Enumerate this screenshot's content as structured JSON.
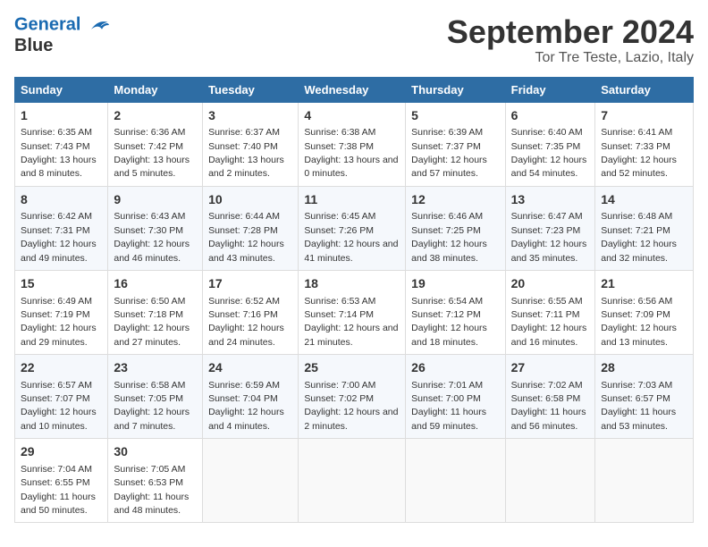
{
  "header": {
    "logo_line1": "General",
    "logo_line2": "Blue",
    "month": "September 2024",
    "location": "Tor Tre Teste, Lazio, Italy"
  },
  "columns": [
    "Sunday",
    "Monday",
    "Tuesday",
    "Wednesday",
    "Thursday",
    "Friday",
    "Saturday"
  ],
  "weeks": [
    [
      {
        "day": "1",
        "sunrise": "Sunrise: 6:35 AM",
        "sunset": "Sunset: 7:43 PM",
        "daylight": "Daylight: 13 hours and 8 minutes."
      },
      {
        "day": "2",
        "sunrise": "Sunrise: 6:36 AM",
        "sunset": "Sunset: 7:42 PM",
        "daylight": "Daylight: 13 hours and 5 minutes."
      },
      {
        "day": "3",
        "sunrise": "Sunrise: 6:37 AM",
        "sunset": "Sunset: 7:40 PM",
        "daylight": "Daylight: 13 hours and 2 minutes."
      },
      {
        "day": "4",
        "sunrise": "Sunrise: 6:38 AM",
        "sunset": "Sunset: 7:38 PM",
        "daylight": "Daylight: 13 hours and 0 minutes."
      },
      {
        "day": "5",
        "sunrise": "Sunrise: 6:39 AM",
        "sunset": "Sunset: 7:37 PM",
        "daylight": "Daylight: 12 hours and 57 minutes."
      },
      {
        "day": "6",
        "sunrise": "Sunrise: 6:40 AM",
        "sunset": "Sunset: 7:35 PM",
        "daylight": "Daylight: 12 hours and 54 minutes."
      },
      {
        "day": "7",
        "sunrise": "Sunrise: 6:41 AM",
        "sunset": "Sunset: 7:33 PM",
        "daylight": "Daylight: 12 hours and 52 minutes."
      }
    ],
    [
      {
        "day": "8",
        "sunrise": "Sunrise: 6:42 AM",
        "sunset": "Sunset: 7:31 PM",
        "daylight": "Daylight: 12 hours and 49 minutes."
      },
      {
        "day": "9",
        "sunrise": "Sunrise: 6:43 AM",
        "sunset": "Sunset: 7:30 PM",
        "daylight": "Daylight: 12 hours and 46 minutes."
      },
      {
        "day": "10",
        "sunrise": "Sunrise: 6:44 AM",
        "sunset": "Sunset: 7:28 PM",
        "daylight": "Daylight: 12 hours and 43 minutes."
      },
      {
        "day": "11",
        "sunrise": "Sunrise: 6:45 AM",
        "sunset": "Sunset: 7:26 PM",
        "daylight": "Daylight: 12 hours and 41 minutes."
      },
      {
        "day": "12",
        "sunrise": "Sunrise: 6:46 AM",
        "sunset": "Sunset: 7:25 PM",
        "daylight": "Daylight: 12 hours and 38 minutes."
      },
      {
        "day": "13",
        "sunrise": "Sunrise: 6:47 AM",
        "sunset": "Sunset: 7:23 PM",
        "daylight": "Daylight: 12 hours and 35 minutes."
      },
      {
        "day": "14",
        "sunrise": "Sunrise: 6:48 AM",
        "sunset": "Sunset: 7:21 PM",
        "daylight": "Daylight: 12 hours and 32 minutes."
      }
    ],
    [
      {
        "day": "15",
        "sunrise": "Sunrise: 6:49 AM",
        "sunset": "Sunset: 7:19 PM",
        "daylight": "Daylight: 12 hours and 29 minutes."
      },
      {
        "day": "16",
        "sunrise": "Sunrise: 6:50 AM",
        "sunset": "Sunset: 7:18 PM",
        "daylight": "Daylight: 12 hours and 27 minutes."
      },
      {
        "day": "17",
        "sunrise": "Sunrise: 6:52 AM",
        "sunset": "Sunset: 7:16 PM",
        "daylight": "Daylight: 12 hours and 24 minutes."
      },
      {
        "day": "18",
        "sunrise": "Sunrise: 6:53 AM",
        "sunset": "Sunset: 7:14 PM",
        "daylight": "Daylight: 12 hours and 21 minutes."
      },
      {
        "day": "19",
        "sunrise": "Sunrise: 6:54 AM",
        "sunset": "Sunset: 7:12 PM",
        "daylight": "Daylight: 12 hours and 18 minutes."
      },
      {
        "day": "20",
        "sunrise": "Sunrise: 6:55 AM",
        "sunset": "Sunset: 7:11 PM",
        "daylight": "Daylight: 12 hours and 16 minutes."
      },
      {
        "day": "21",
        "sunrise": "Sunrise: 6:56 AM",
        "sunset": "Sunset: 7:09 PM",
        "daylight": "Daylight: 12 hours and 13 minutes."
      }
    ],
    [
      {
        "day": "22",
        "sunrise": "Sunrise: 6:57 AM",
        "sunset": "Sunset: 7:07 PM",
        "daylight": "Daylight: 12 hours and 10 minutes."
      },
      {
        "day": "23",
        "sunrise": "Sunrise: 6:58 AM",
        "sunset": "Sunset: 7:05 PM",
        "daylight": "Daylight: 12 hours and 7 minutes."
      },
      {
        "day": "24",
        "sunrise": "Sunrise: 6:59 AM",
        "sunset": "Sunset: 7:04 PM",
        "daylight": "Daylight: 12 hours and 4 minutes."
      },
      {
        "day": "25",
        "sunrise": "Sunrise: 7:00 AM",
        "sunset": "Sunset: 7:02 PM",
        "daylight": "Daylight: 12 hours and 2 minutes."
      },
      {
        "day": "26",
        "sunrise": "Sunrise: 7:01 AM",
        "sunset": "Sunset: 7:00 PM",
        "daylight": "Daylight: 11 hours and 59 minutes."
      },
      {
        "day": "27",
        "sunrise": "Sunrise: 7:02 AM",
        "sunset": "Sunset: 6:58 PM",
        "daylight": "Daylight: 11 hours and 56 minutes."
      },
      {
        "day": "28",
        "sunrise": "Sunrise: 7:03 AM",
        "sunset": "Sunset: 6:57 PM",
        "daylight": "Daylight: 11 hours and 53 minutes."
      }
    ],
    [
      {
        "day": "29",
        "sunrise": "Sunrise: 7:04 AM",
        "sunset": "Sunset: 6:55 PM",
        "daylight": "Daylight: 11 hours and 50 minutes."
      },
      {
        "day": "30",
        "sunrise": "Sunrise: 7:05 AM",
        "sunset": "Sunset: 6:53 PM",
        "daylight": "Daylight: 11 hours and 48 minutes."
      },
      null,
      null,
      null,
      null,
      null
    ]
  ]
}
